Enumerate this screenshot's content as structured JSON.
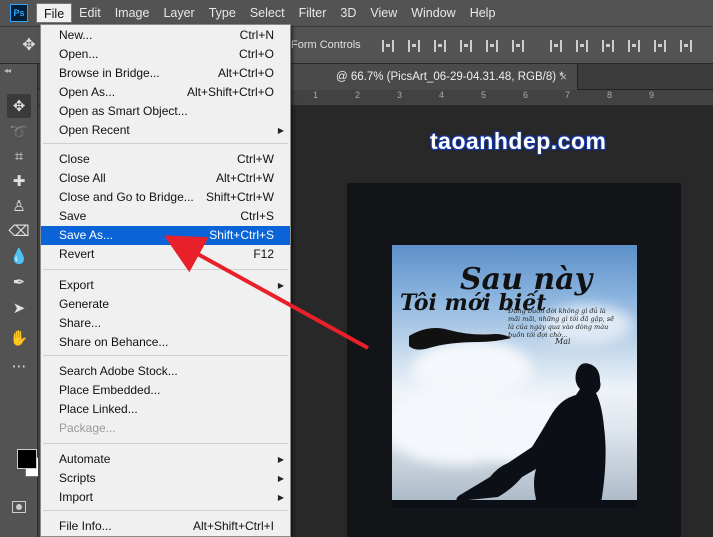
{
  "app": {
    "logo": "Ps"
  },
  "menubar": {
    "items": [
      "File",
      "Edit",
      "Image",
      "Layer",
      "Type",
      "Select",
      "Filter",
      "3D",
      "View",
      "Window",
      "Help"
    ]
  },
  "options_bar": {
    "transform_label": "Form Controls"
  },
  "document": {
    "tab_title": "@ 66.7% (PicsArt_06-29-04.31.48, RGB/8) *",
    "close_glyph": "×"
  },
  "ruler": {
    "top_numbers": [
      "1",
      "2",
      "3",
      "4",
      "5",
      "6",
      "7",
      "8",
      "9"
    ]
  },
  "watermark": "taoanhdep.com",
  "photo": {
    "title_line1": "Sau này",
    "title_line2": "Tôi mới biết",
    "small_text": "Đừng buồn đời không gì đủ là mãi mãi, những gì tôi đã gặp, sẽ là của ngày qua vào dòng màu buồn tôi đợi chờ...",
    "signature": "Mai"
  },
  "file_menu": {
    "items": [
      {
        "label": "New...",
        "shortcut": "Ctrl+N"
      },
      {
        "label": "Open...",
        "shortcut": "Ctrl+O"
      },
      {
        "label": "Browse in Bridge...",
        "shortcut": "Alt+Ctrl+O"
      },
      {
        "label": "Open As...",
        "shortcut": "Alt+Shift+Ctrl+O"
      },
      {
        "label": "Open as Smart Object...",
        "shortcut": ""
      },
      {
        "label": "Open Recent",
        "shortcut": "",
        "submenu": true
      },
      {
        "label": "Close",
        "shortcut": "Ctrl+W"
      },
      {
        "label": "Close All",
        "shortcut": "Alt+Ctrl+W"
      },
      {
        "label": "Close and Go to Bridge...",
        "shortcut": "Shift+Ctrl+W"
      },
      {
        "label": "Save",
        "shortcut": "Ctrl+S"
      },
      {
        "label": "Save As...",
        "shortcut": "Shift+Ctrl+S",
        "highlighted": true
      },
      {
        "label": "Revert",
        "shortcut": "F12"
      },
      {
        "label": "Export",
        "shortcut": "",
        "submenu": true
      },
      {
        "label": "Generate",
        "shortcut": ""
      },
      {
        "label": "Share...",
        "shortcut": ""
      },
      {
        "label": "Share on Behance...",
        "shortcut": ""
      },
      {
        "label": "Search Adobe Stock...",
        "shortcut": ""
      },
      {
        "label": "Place Embedded...",
        "shortcut": ""
      },
      {
        "label": "Place Linked...",
        "shortcut": ""
      },
      {
        "label": "Package...",
        "shortcut": "",
        "disabled": true
      },
      {
        "label": "Automate",
        "shortcut": "",
        "submenu": true
      },
      {
        "label": "Scripts",
        "shortcut": "",
        "submenu": true
      },
      {
        "label": "Import",
        "shortcut": "",
        "submenu": true
      },
      {
        "label": "File Info...",
        "shortcut": "Alt+Shift+Ctrl+I"
      }
    ],
    "submenu_glyph": "▶"
  },
  "colors": {
    "highlight": "#0a64d8",
    "arrow": "#e8202a",
    "menu_bg": "#f0f0f0",
    "ui_bg": "#535353"
  }
}
